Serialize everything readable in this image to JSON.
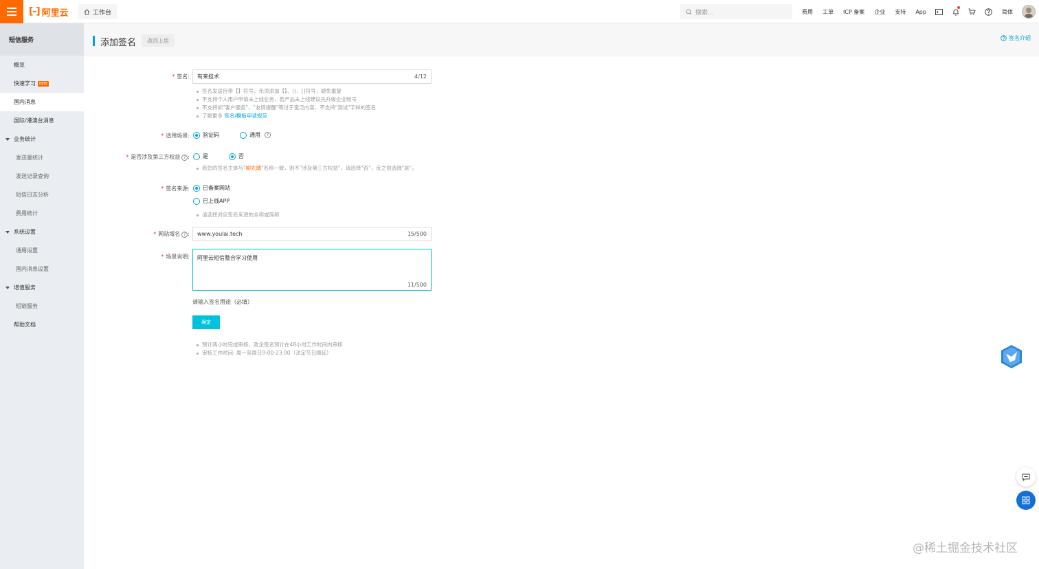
{
  "topbar": {
    "logo_text": "阿里云",
    "workbench": "工作台",
    "search_placeholder": "搜索...",
    "nav": [
      "费用",
      "工单",
      "ICP 备案",
      "企业",
      "支持",
      "App"
    ],
    "lang": "简体",
    "icons": [
      "terminal-icon",
      "bell-icon",
      "cart-icon",
      "help-icon"
    ]
  },
  "sidebar": {
    "title": "短信服务",
    "items": [
      {
        "label": "概览",
        "type": "item"
      },
      {
        "label": "快速学习",
        "type": "item",
        "badge": "NEW"
      },
      {
        "label": "国内消息",
        "type": "item",
        "active": true
      },
      {
        "label": "国际/港澳台消息",
        "type": "item"
      },
      {
        "label": "业务统计",
        "type": "group"
      },
      {
        "label": "发送量统计",
        "type": "sub"
      },
      {
        "label": "发送记录查询",
        "type": "sub"
      },
      {
        "label": "短信日志分析",
        "type": "sub"
      },
      {
        "label": "费用统计",
        "type": "sub"
      },
      {
        "label": "系统设置",
        "type": "group"
      },
      {
        "label": "通用设置",
        "type": "sub"
      },
      {
        "label": "国内消息设置",
        "type": "sub"
      },
      {
        "label": "增值服务",
        "type": "group"
      },
      {
        "label": "短链服务",
        "type": "sub"
      },
      {
        "label": "帮助文档",
        "type": "item"
      }
    ]
  },
  "page": {
    "title": "添加签名",
    "back": "返回上层",
    "intro_link": "签名介绍"
  },
  "form": {
    "signature": {
      "label": "签名:",
      "value": "有来技术",
      "count": "4/12"
    },
    "signature_hints": {
      "h1": "签名发送自带【】符号，无须添加【】、()、[]符号，避免重复",
      "h2": "不支持个人用户申请未上线业务，若产品未上线建议先升级企业账号",
      "h3": "不支持如\"客户服务\"、\"友情提醒\"等过于宽泛内容、不支持\"测试\"字样的签名",
      "h4_prefix": "了解更多 ",
      "h4_link": "签名/模板申请规范"
    },
    "scene": {
      "label": "适用场景:",
      "opt1": "验证码",
      "opt2": "通用"
    },
    "third_party": {
      "label": "是否涉及第三方权益",
      "opt1": "是",
      "opt2": "否"
    },
    "third_party_hint": {
      "prefix": "若您的签名主体与\"",
      "highlight": "柳先瑞",
      "suffix": "\"名称一致，则不\"涉及第三方权益\"，请选择\"否\"，反之则选择\"是\"。"
    },
    "source": {
      "label": "签名来源:",
      "opt1": "已备案网站",
      "opt2": "已上线APP"
    },
    "source_hint": "请选择对应签名来源的全称或简称",
    "domain": {
      "label": "网站域名",
      "value": "www.youlai.tech",
      "count": "15/500"
    },
    "scene_desc": {
      "label": "场景说明:",
      "value": "阿里云短信整合学习使用",
      "count": "11/500"
    },
    "purpose_hint": "请输入签名用途（必填）",
    "confirm": "确定",
    "footer_hints": {
      "f1": "预计两小时完成审核，政企签名预计在48小时工作时间内审核",
      "f2": "审核工作时间: 周一至周日9:00-23:00（法定节日顺延）"
    }
  },
  "watermark": "@稀土掘金技术社区",
  "colors": {
    "brand": "#ff6a00",
    "accent": "#00a1d6",
    "button": "#00c1de",
    "required": "#e4393c"
  }
}
